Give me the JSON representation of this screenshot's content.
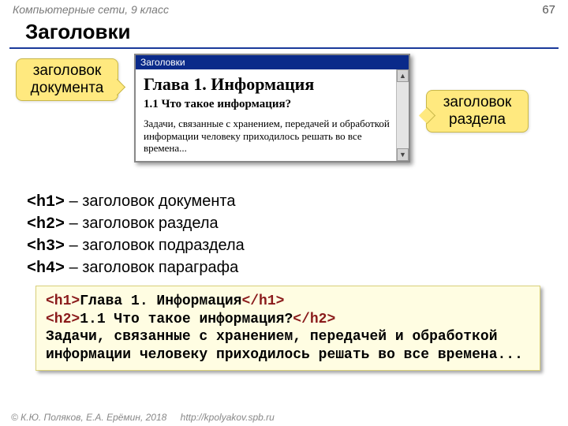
{
  "header": {
    "course": "Компьютерные сети, 9 класс",
    "page": "67"
  },
  "title": "Заголовки",
  "callouts": {
    "left": "заголовок документа",
    "right": "заголовок раздела"
  },
  "browser": {
    "title": "Заголовки",
    "h1": "Глава 1. Информация",
    "h2": "1.1 Что такое информация?",
    "p": "Задачи, связанные с хранением, передачей и обработкой информации человеку приходилось решать во все времена..."
  },
  "defs": [
    {
      "tag": "<h1>",
      "desc": " – заголовок документа"
    },
    {
      "tag": "<h2>",
      "desc": " – заголовок раздела"
    },
    {
      "tag": "<h3>",
      "desc": " – заголовок подраздела"
    },
    {
      "tag": "<h4>",
      "desc": " – заголовок параграфа"
    }
  ],
  "code": {
    "l1_open": "<h1>",
    "l1_text": "Глава 1. Информация",
    "l1_close": "</h1>",
    "l2_open": "<h2>",
    "l2_text": "1.1 Что такое информация?",
    "l2_close": "</h2>",
    "l3": "Задачи, связанные с хранением, передачей и обработкой информации человеку приходилось решать во все времена..."
  },
  "footer": {
    "copyright": "© К.Ю. Поляков, Е.А. Ерёмин, 2018",
    "url": "http://kpolyakov.spb.ru"
  }
}
